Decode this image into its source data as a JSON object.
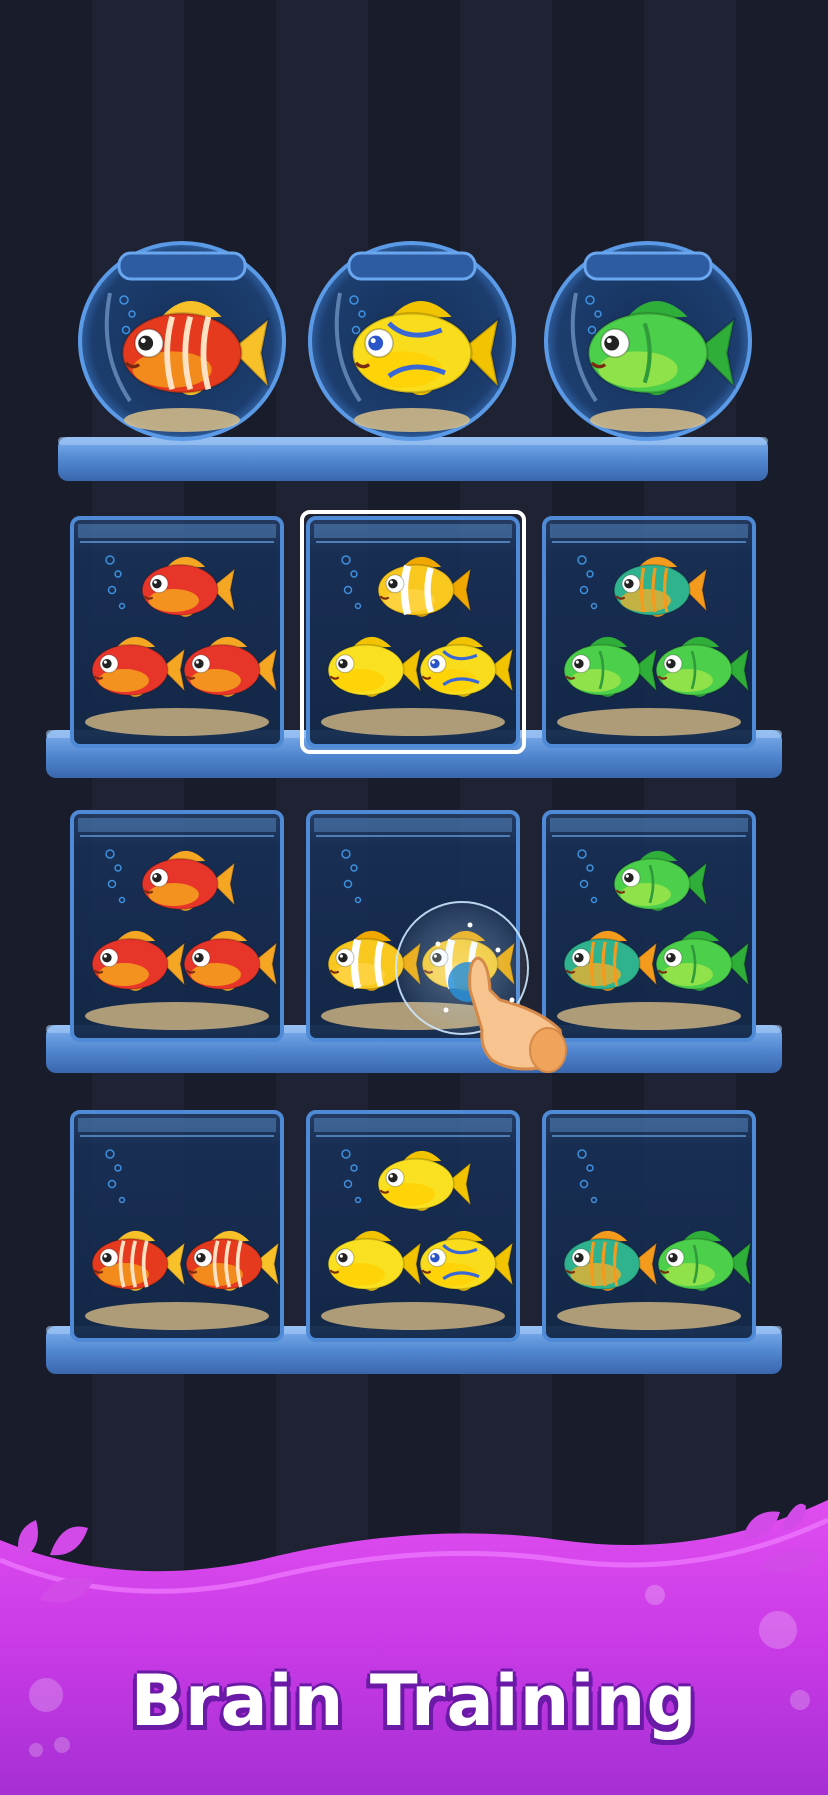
{
  "banner": {
    "title": "Brain Training"
  },
  "colors": {
    "background": "#1c1f2e",
    "shelf": "#5a8fd6",
    "tank": "#1e3a66",
    "banner": "#c53be0",
    "selection": "#ffffff"
  },
  "bowls": [
    {
      "fish": [
        "red-stripe"
      ]
    },
    {
      "fish": [
        "yellow-blue"
      ]
    },
    {
      "fish": [
        "green-fish"
      ]
    }
  ],
  "tanks": [
    [
      {
        "fish": [
          "red-fish",
          "red-fish",
          "red-fish"
        ],
        "selected": false
      },
      {
        "fish": [
          "clownfish",
          "yellow-fish",
          "yellow-blue"
        ],
        "selected": true
      },
      {
        "fish": [
          "teal-stripe",
          "green-fish",
          "green-fish"
        ],
        "selected": false
      }
    ],
    [
      {
        "fish": [
          "red-fish",
          "red-fish",
          "red-fish"
        ],
        "selected": false
      },
      {
        "fish": [
          "clownfish",
          "clownfish"
        ],
        "selected": false
      },
      {
        "fish": [
          "green-fish",
          "teal-stripe",
          "green-fish"
        ],
        "selected": false
      }
    ],
    [
      {
        "fish": [
          "red-stripe",
          "red-stripe"
        ],
        "selected": false
      },
      {
        "fish": [
          "yellow-fish",
          "yellow-fish",
          "yellow-blue"
        ],
        "selected": false
      },
      {
        "fish": [
          "teal-stripe",
          "green-fish"
        ],
        "selected": false
      }
    ]
  ],
  "hint": {
    "icon": "pointing-hand-icon"
  }
}
